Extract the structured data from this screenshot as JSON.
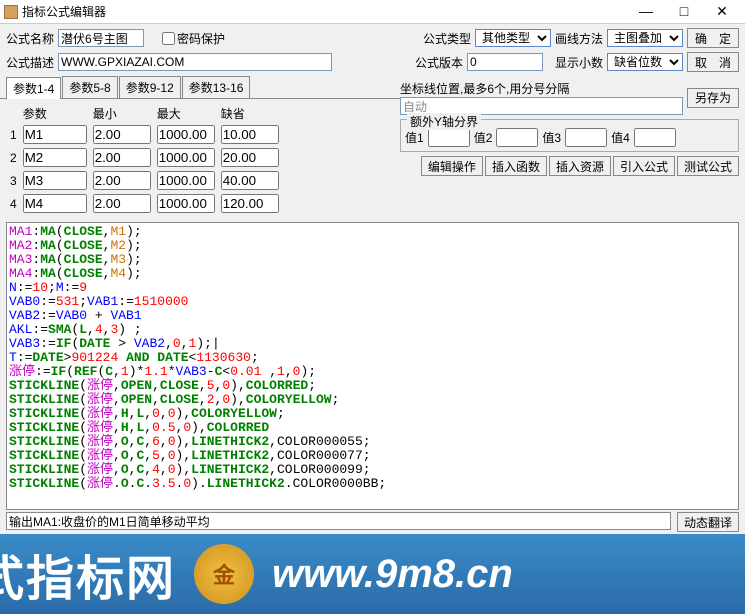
{
  "window": {
    "title": "指标公式编辑器",
    "min": "—",
    "max": "□",
    "close": "✕"
  },
  "labels": {
    "name": "公式名称",
    "password": "密码保护",
    "type": "公式类型",
    "drawmethod": "画线方法",
    "confirm": "确　定",
    "desc": "公式描述",
    "version": "公式版本",
    "decimals": "显示小数",
    "cancel": "取　消",
    "saveas": "另存为",
    "param": "参数",
    "min_h": "最小",
    "max_h": "最大",
    "default_h": "缺省",
    "axispos": "坐标线位置,最多6个,用分号分隔",
    "auto": "自动",
    "extraY": "额外Y轴分界",
    "v1": "值1",
    "v2": "值2",
    "v3": "值3",
    "v4": "值4",
    "editop": "编辑操作",
    "insfunc": "插入函数",
    "insres": "插入资源",
    "import": "引入公式",
    "test": "测试公式"
  },
  "values": {
    "name": "潜伏6号主图",
    "desc": "WWW.GPXIAZAI.COM",
    "type": "其他类型",
    "drawmethod": "主图叠加",
    "version": "0",
    "decimals": "缺省位数"
  },
  "tabs": [
    "参数1-4",
    "参数5-8",
    "参数9-12",
    "参数13-16"
  ],
  "params": [
    {
      "n": "1",
      "name": "M1",
      "min": "2.00",
      "max": "1000.00",
      "def": "10.00"
    },
    {
      "n": "2",
      "name": "M2",
      "min": "2.00",
      "max": "1000.00",
      "def": "20.00"
    },
    {
      "n": "3",
      "name": "M3",
      "min": "2.00",
      "max": "1000.00",
      "def": "40.00"
    },
    {
      "n": "4",
      "name": "M4",
      "min": "2.00",
      "max": "1000.00",
      "def": "120.00"
    }
  ],
  "status": {
    "output": "输出MA1:收盘价的M1日简单移动平均",
    "dynbtn": "动态翻译"
  },
  "banner": {
    "chinese": "式指标网",
    "url": "www.9m8.cn"
  }
}
